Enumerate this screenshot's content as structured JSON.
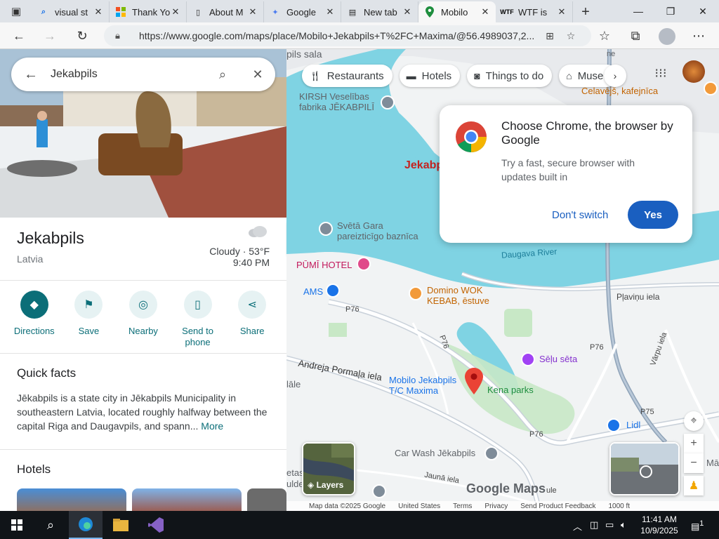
{
  "browser": {
    "tabs": [
      {
        "label": "visual st",
        "icon": "search-icon",
        "active": false
      },
      {
        "label": "Thank Yo",
        "icon": "microsoft-icon",
        "active": false
      },
      {
        "label": "About M",
        "icon": "document-icon",
        "active": false
      },
      {
        "label": "Google",
        "icon": "gemini-icon",
        "active": false
      },
      {
        "label": "New tab",
        "icon": "newtab-icon",
        "active": false
      },
      {
        "label": "Mobilo",
        "icon": "maps-icon",
        "active": true
      },
      {
        "label": "WTF is",
        "icon": "wtf-icon",
        "active": false
      }
    ],
    "url": "https://www.google.com/maps/place/Mobilo+Jekabpils+T%2FC+Maxima/@56.4989037,2..."
  },
  "panel": {
    "search_text": "Jekabpils",
    "place_title": "Jekabpils",
    "place_subtitle": "Latvia",
    "weather_line1": "Cloudy · 53°F",
    "weather_line2": "9:40 PM",
    "actions": [
      {
        "label": "Directions",
        "icon": "directions-icon"
      },
      {
        "label": "Save",
        "icon": "bookmark-icon"
      },
      {
        "label": "Nearby",
        "icon": "nearby-icon"
      },
      {
        "label": "Send to phone",
        "icon": "phone-icon"
      },
      {
        "label": "Share",
        "icon": "share-icon"
      }
    ],
    "quick_facts_title": "Quick facts",
    "quick_facts_text": "Jēkabpils is a state city in Jēkabpils Municipality in southeastern Latvia, located roughly halfway between the capital Riga and Daugavpils, and spann...",
    "quick_facts_more": "More",
    "hotels_title": "Hotels"
  },
  "map": {
    "chips": [
      {
        "label": "Restaurants",
        "icon": "fork-knife-icon"
      },
      {
        "label": "Hotels",
        "icon": "bed-icon"
      },
      {
        "label": "Things to do",
        "icon": "camera-icon"
      },
      {
        "label": "Museum",
        "icon": "museum-icon"
      }
    ],
    "labels": {
      "pils_sala": "pils sala",
      "kirsh": "KIRSH Veselības\nfabrika JĒKABPILĪ",
      "jekabpils": "Jekabp",
      "cafe": "Celavējš, kafejnīca",
      "svetagara": "Svētā Gara\npareizticīgo baznīca",
      "pumi": "PŪMĪ HOTEL",
      "ams": "AMS",
      "domino": "Domino WOK\nKEBAB, ēstuve",
      "daugava": "Daugava River",
      "plavinu": "Pļaviņu iela",
      "p76a": "P76",
      "p76b": "P76",
      "p76c": "P76",
      "p76d": "P76",
      "p75": "P75",
      "varpu": "Vārpu iela",
      "andreja": "Andreja Pormaļa iela",
      "seju": "Sēļu sēta",
      "mobilo": "Mobilo Jekabpils\nT/C Maxima",
      "kena": "Kena parks",
      "lidl": "Lidl",
      "carwash": "Car Wash Jēkabpils",
      "jauna": "Jaunā iela",
      "lale": "lāle",
      "etas": "etas",
      "ulde": "ulde",
      "ule": "ule",
      "ma": "Mā",
      "ne": "ne"
    },
    "promo": {
      "title": "Choose Chrome, the browser by Google",
      "body": "Try a fast, secure browser with updates built in",
      "dont_switch": "Don't switch",
      "yes": "Yes"
    },
    "layers_label": "Layers",
    "google_maps": "Google Maps",
    "footer": {
      "map_data": "Map data ©2025 Google",
      "country": "United States",
      "terms": "Terms",
      "privacy": "Privacy",
      "feedback": "Send Product Feedback",
      "scale": "1000 ft"
    }
  },
  "taskbar": {
    "time": "11:41 AM",
    "date": "10/9/2025",
    "notification_count": "1"
  },
  "colors": {
    "accent": "#0b6e78",
    "water": "#7fd3e3",
    "park": "#c8e8c6",
    "chrome_button": "#1a5fc0"
  }
}
